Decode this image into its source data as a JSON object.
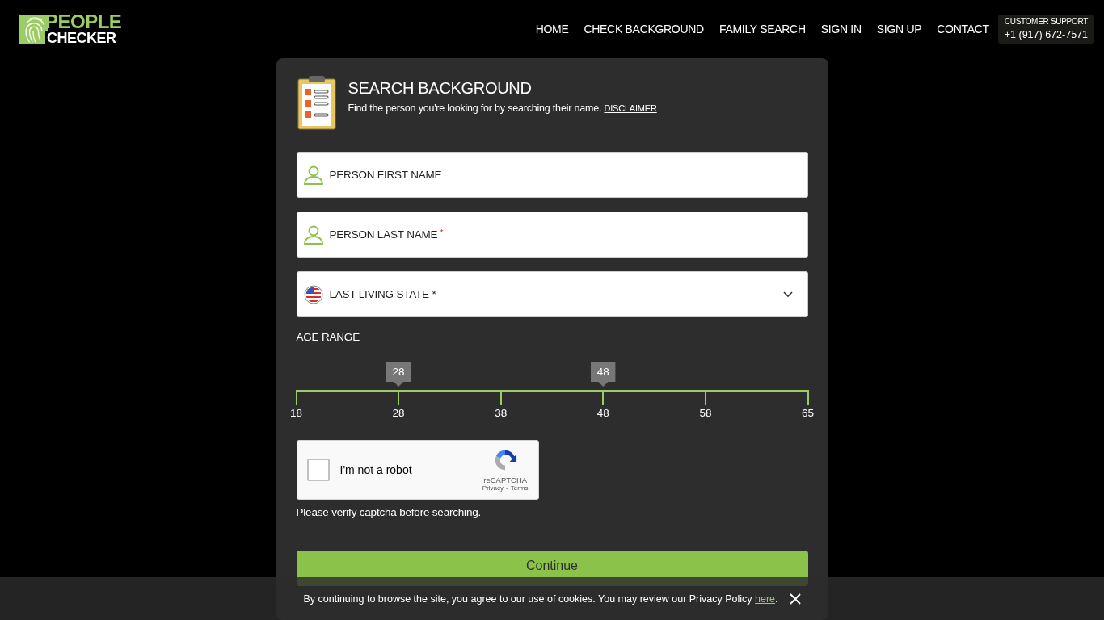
{
  "header": {
    "logo": {
      "line_1": "PEOPLE",
      "line_2": "CHECKER"
    },
    "nav": [
      {
        "label": "HOME"
      },
      {
        "label": "CHECK BACKGROUND"
      },
      {
        "label": "FAMILY SEARCH"
      },
      {
        "label": "SIGN IN"
      },
      {
        "label": "SIGN UP"
      },
      {
        "label": "CONTACT"
      }
    ],
    "support": {
      "label": "CUSTOMER SUPPORT",
      "phone": "+1 (917) 672-7571"
    }
  },
  "form": {
    "title": "SEARCH BACKGROUND",
    "subtitle": "Find the person you're looking for by searching their name.",
    "disclaimer": "DISCLAIMER",
    "fields": [
      {
        "kind": "text",
        "placeholder": "PERSON FIRST NAME"
      },
      {
        "kind": "text",
        "placeholder": "PERSON LAST NAME",
        "required_mark": "*"
      },
      {
        "kind": "select",
        "placeholder": "LAST LIVING STATE *"
      }
    ],
    "age_range": {
      "label": "AGE RANGE",
      "handles": [
        {
          "value": "28",
          "level": 0.2
        },
        {
          "value": "48",
          "level": 0.6
        }
      ],
      "ticks": [
        "18",
        "28",
        "38",
        "48",
        "58",
        "65"
      ]
    },
    "captcha": {
      "label": "I'm not a robot",
      "checked": false,
      "brand": "reCAPTCHA",
      "privacy": "Privacy",
      "separator": "-",
      "terms": "Terms"
    },
    "error": "Please verify captcha before searching.",
    "submit": "Continue"
  },
  "cookie_bar": {
    "text": "By continuing to browse the site, you agree to our use of cookies. You may review our Privacy Policy",
    "link": "here",
    "end": "."
  }
}
